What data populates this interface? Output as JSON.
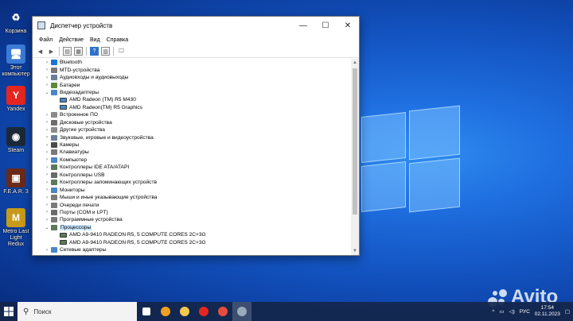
{
  "desktop": {
    "icons": [
      {
        "label": "Корзина",
        "icon": "recycle-bin-icon"
      },
      {
        "label": "Этот компьютер",
        "icon": "computer-icon"
      },
      {
        "label": "Yandex",
        "icon": "yandex-browser-icon"
      },
      {
        "label": "Steam",
        "icon": "steam-icon"
      },
      {
        "label": "F.E.A.R. 3",
        "icon": "fear3-game-icon"
      },
      {
        "label": "Metro Last Light Redux",
        "icon": "metro-game-icon"
      }
    ]
  },
  "window": {
    "title": "Диспетчер устройств",
    "controls": {
      "minimize": "—",
      "maximize": "☐",
      "close": "✕"
    },
    "menu": [
      "Файл",
      "Действие",
      "Вид",
      "Справка"
    ],
    "tree": [
      {
        "label": "Bluetooth",
        "icon": "bluetooth-icon",
        "color": "#1a73d9",
        "expanded": false
      },
      {
        "label": "MTD-устройства",
        "icon": "mtd-device-icon",
        "color": "#7a7a7a",
        "expanded": false
      },
      {
        "label": "Аудиовходы и аудиовыходы",
        "icon": "audio-icon",
        "color": "#6a7f99",
        "expanded": false
      },
      {
        "label": "Батареи",
        "icon": "battery-icon",
        "color": "#5c8a3a",
        "expanded": false
      },
      {
        "label": "Видеоадаптеры",
        "icon": "display-adapter-icon",
        "color": "#4a86c8",
        "expanded": true,
        "children": [
          "AMD Radeon (TM) R5 M430",
          "AMD Radeon(TM) R5 Graphics"
        ]
      },
      {
        "label": "Встроенное ПО",
        "icon": "firmware-icon",
        "color": "#8a8a8a",
        "expanded": false
      },
      {
        "label": "Дисковые устройства",
        "icon": "disk-icon",
        "color": "#6d6d6d",
        "expanded": false
      },
      {
        "label": "Другие устройства",
        "icon": "other-devices-icon",
        "color": "#8c8c8c",
        "expanded": false
      },
      {
        "label": "Звуковые, игровые и видеоустройства",
        "icon": "sound-icon",
        "color": "#6a7f99",
        "expanded": false
      },
      {
        "label": "Камеры",
        "icon": "camera-icon",
        "color": "#4a4a4a",
        "expanded": false
      },
      {
        "label": "Клавиатуры",
        "icon": "keyboard-icon",
        "color": "#7a7a7a",
        "expanded": false
      },
      {
        "label": "Компьютер",
        "icon": "computer-icon",
        "color": "#4a86c8",
        "expanded": false
      },
      {
        "label": "Контроллеры IDE ATA/ATAPI",
        "icon": "ide-controller-icon",
        "color": "#5a7a5a",
        "expanded": false
      },
      {
        "label": "Контроллеры USB",
        "icon": "usb-icon",
        "color": "#6a6a6a",
        "expanded": false
      },
      {
        "label": "Контроллеры запоминающих устройств",
        "icon": "storage-controller-icon",
        "color": "#5a7a5a",
        "expanded": false
      },
      {
        "label": "Мониторы",
        "icon": "monitor-icon",
        "color": "#4a86c8",
        "expanded": false
      },
      {
        "label": "Мыши и иные указывающие устройства",
        "icon": "mouse-icon",
        "color": "#7a7a7a",
        "expanded": false
      },
      {
        "label": "Очереди печати",
        "icon": "printer-icon",
        "color": "#7a7a7a",
        "expanded": false
      },
      {
        "label": "Порты (COM и LPT)",
        "icon": "port-icon",
        "color": "#6a6a6a",
        "expanded": false
      },
      {
        "label": "Программные устройства",
        "icon": "software-device-icon",
        "color": "#7a7a7a",
        "expanded": false
      },
      {
        "label": "Процессоры",
        "icon": "processor-icon",
        "color": "#5a7a5a",
        "expanded": true,
        "selected": true,
        "children": [
          "AMD A9-9410 RADEON R5, 5 COMPUTE CORES 2C+3G",
          "AMD A9-9410 RADEON R5, 5 COMPUTE CORES 2C+3G"
        ]
      },
      {
        "label": "Сетевые адаптеры",
        "icon": "network-adapter-icon",
        "color": "#4a86c8",
        "expanded": false
      }
    ]
  },
  "taskbar": {
    "search_placeholder": "Поиск",
    "apps": [
      {
        "icon": "task-view-icon",
        "color": "#ffffff"
      },
      {
        "icon": "yandex-browser-icon",
        "color": "#f0a020"
      },
      {
        "icon": "file-explorer-icon",
        "color": "#f2c94c"
      },
      {
        "icon": "yandex-icon",
        "color": "#e52620"
      },
      {
        "icon": "yandex-music-icon",
        "color": "#e84c3d"
      },
      {
        "icon": "device-manager-icon",
        "color": "#9ab"
      }
    ],
    "language": "РУС",
    "time": "17:54",
    "date": "02.11.2023"
  },
  "watermark": "Avito"
}
